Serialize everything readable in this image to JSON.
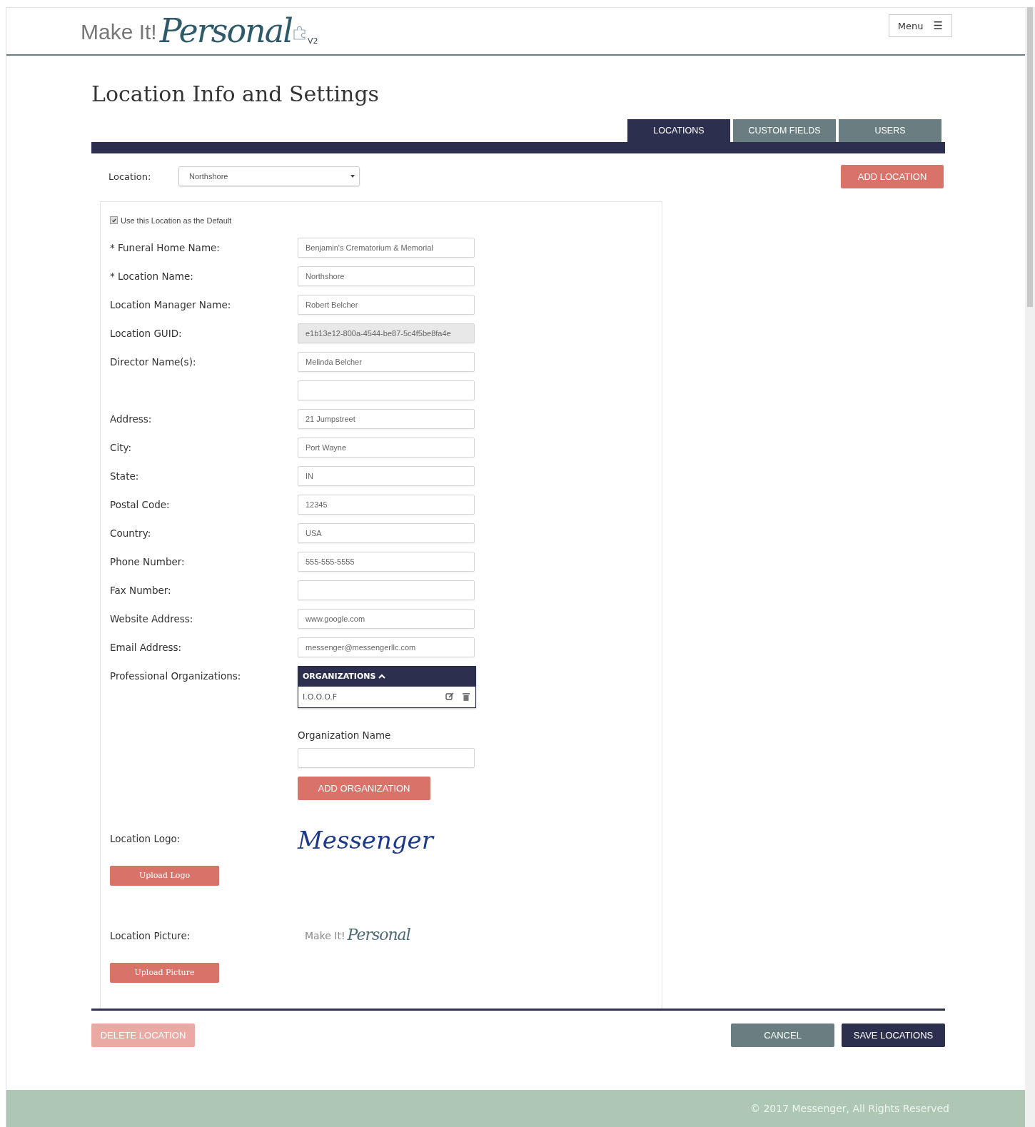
{
  "header": {
    "logo": {
      "prefix": "Make It!",
      "script": "Personal",
      "suffix": "V2"
    },
    "menu_button": {
      "label": "Menu",
      "icon": "☰"
    }
  },
  "page_title": "Location Info and Settings",
  "tabs": [
    {
      "label": "LOCATIONS",
      "selected": true
    },
    {
      "label": "CUSTOM FIELDS",
      "selected": false
    },
    {
      "label": "USERS",
      "selected": false
    }
  ],
  "location_select": {
    "label": "Location:",
    "value": "Northshore"
  },
  "add_location_button": "ADD LOCATION",
  "default_checkbox": {
    "label": "Use this Location as the Default",
    "checked": true
  },
  "fields": [
    {
      "label": "* Funeral Home Name:",
      "value": "Benjamin's Crematorium & Memorial",
      "disabled": false
    },
    {
      "label": "* Location Name:",
      "value": "Northshore",
      "disabled": false
    },
    {
      "label": "Location Manager Name:",
      "value": "Robert Belcher",
      "disabled": false
    },
    {
      "label": "Location GUID:",
      "value": "e1b13e12-800a-4544-be87-5c4f5be8fa4e",
      "disabled": true
    },
    {
      "label": "Director Name(s):",
      "value": "Melinda Belcher",
      "disabled": false
    },
    {
      "disabled": false
    },
    {
      "label": "Address:",
      "value": "21 Jumpstreet",
      "disabled": false
    },
    {
      "label": "City:",
      "value": "Port Wayne",
      "disabled": false
    },
    {
      "label": "State:",
      "value": "IN",
      "disabled": false
    },
    {
      "label": "Postal Code:",
      "value": "12345",
      "disabled": false
    },
    {
      "label": "Country:",
      "value": "USA",
      "disabled": false
    },
    {
      "label": "Phone Number:",
      "value": "555-555-5555",
      "disabled": false
    },
    {
      "label": "Fax Number:",
      "disabled": false
    },
    {
      "label": "Website Address:",
      "value": "www.google.com",
      "disabled": false
    },
    {
      "label": "Email Address:",
      "value": "messenger@messengerllc.com",
      "disabled": false
    }
  ],
  "organizations": {
    "label": "Professional Organizations:",
    "header": "ORGANIZATIONS",
    "expanded": true,
    "items": [
      "I.O.O.O.F"
    ],
    "name_label": "Organization Name",
    "add_button": "ADD ORGANIZATION"
  },
  "logo_section": {
    "label": "Location Logo:",
    "logo_text": "Messenger",
    "button": "Upload Logo"
  },
  "picture_section": {
    "label": "Location Picture:",
    "logo": {
      "prefix": "Make It!",
      "script": "Personal"
    },
    "button": "Upload Picture"
  },
  "footer_buttons": {
    "delete": {
      "label": "DELETE LOCATION",
      "disabled": true
    },
    "cancel": "CANCEL",
    "save": "SAVE LOCATIONS"
  },
  "footer": "© 2017 Messenger, All Rights Reserved"
}
